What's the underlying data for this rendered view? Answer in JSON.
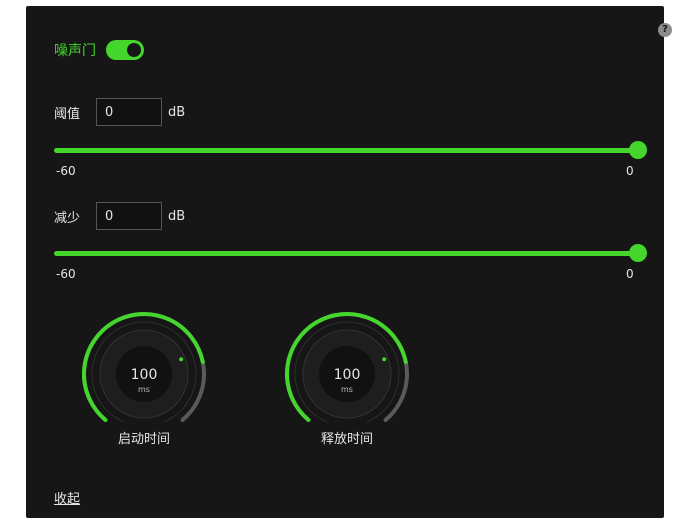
{
  "noise_gate": {
    "title": "噪声门",
    "enabled": true
  },
  "threshold": {
    "label": "阈值",
    "value": "0",
    "unit": "dB",
    "min_label": "-60",
    "max_label": "0",
    "min": -60,
    "max": 0,
    "current": 0
  },
  "reduction": {
    "label": "减少",
    "value": "0",
    "unit": "dB",
    "min_label": "-60",
    "max_label": "0",
    "min": -60,
    "max": 0,
    "current": 0
  },
  "attack": {
    "label": "启动时间",
    "value": "100",
    "unit": "ms",
    "level": 0.78
  },
  "release": {
    "label": "释放时间",
    "value": "100",
    "unit": "ms",
    "level": 0.78
  },
  "collapse_label": "收起",
  "help_icon": "question-circle-icon",
  "colors": {
    "accent": "#44d62c",
    "panel": "#161616",
    "text": "#e6e6e6",
    "track": "#3a3a3a"
  }
}
